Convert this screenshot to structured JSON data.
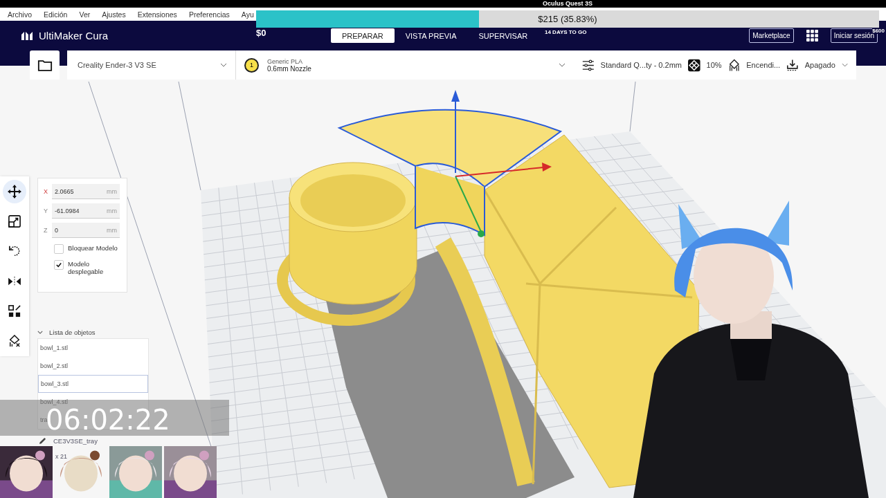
{
  "menu": [
    {
      "label": "Archivo"
    },
    {
      "label": "Edición"
    },
    {
      "label": "Ver"
    },
    {
      "label": "Ajustes"
    },
    {
      "label": "Extensiones"
    },
    {
      "label": "Preferencias"
    },
    {
      "label": "Ayu"
    }
  ],
  "app": {
    "name": "UltiMaker Cura"
  },
  "stages": [
    {
      "label": "PREPARAR",
      "selected": true
    },
    {
      "label": "VISTA PREVIA",
      "selected": false
    },
    {
      "label": "SUPERVISAR",
      "selected": false
    }
  ],
  "header_buttons": [
    {
      "label": "Marketplace",
      "kind": "text"
    },
    {
      "kind": "apps"
    },
    {
      "label": "Iniciar sesión",
      "kind": "text"
    }
  ],
  "printer": {
    "name": "Creality Ender-3 V3 SE"
  },
  "extruder": {
    "number": "1",
    "material": "Generic PLA",
    "nozzle": "0.6mm Nozzle"
  },
  "print_settings": {
    "profile": "Standard Q...ty - 0.2mm",
    "infill": "10%",
    "support": "Encendi...",
    "adhesion": "Apagado"
  },
  "tools": [
    {
      "kind": "move",
      "selected": true
    },
    {
      "kind": "scale",
      "selected": false
    },
    {
      "kind": "rotate",
      "selected": false
    },
    {
      "kind": "mirror",
      "selected": false
    },
    {
      "kind": "per-model",
      "selected": false
    },
    {
      "kind": "support-blocker",
      "selected": false
    }
  ],
  "move_panel": {
    "fields": [
      {
        "axis": "X",
        "value": "2.0665",
        "unit": "mm"
      },
      {
        "axis": "Y",
        "value": "-61.0984",
        "unit": "mm"
      },
      {
        "axis": "Z",
        "value": "0",
        "unit": "mm"
      }
    ],
    "checkboxes": [
      {
        "label": "Bloquear Modelo",
        "checked": false
      },
      {
        "label": "Modelo desplegable",
        "checked": true
      }
    ]
  },
  "object_list": {
    "title": "Lista de objetos",
    "expanded": true,
    "items": [
      {
        "name": "bowl_1.stl",
        "selected": false
      },
      {
        "name": "bowl_2.stl",
        "selected": false
      },
      {
        "name": "bowl_3.stl",
        "selected": true
      },
      {
        "name": "bowl_4.stl",
        "selected": false
      },
      {
        "name": "tra",
        "selected": false
      }
    ]
  },
  "project": {
    "name": "CE3V3SE_tray",
    "dimensions": "x 21"
  },
  "stream_overlay": {
    "goal": {
      "title": "Oculus Quest 3S",
      "raised": "$215 (35.83%)",
      "level": 0.3583,
      "min": "$0",
      "max": "$600",
      "remaining": "14 DAYS TO GO"
    },
    "timer": "06:02:22"
  }
}
